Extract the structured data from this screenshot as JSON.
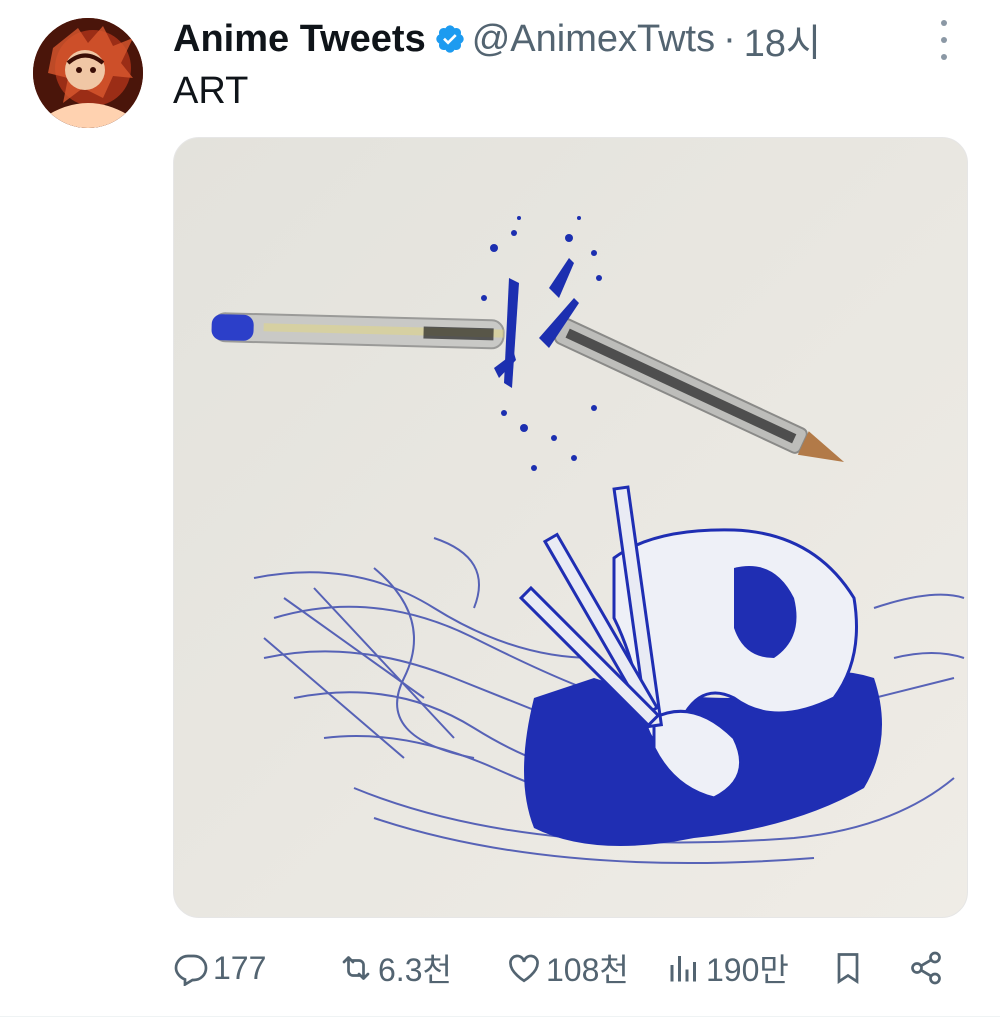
{
  "tweet": {
    "display_name": "Anime Tweets",
    "handle": "@AnimexTwts",
    "separator": "·",
    "time": "18시",
    "text": "ART",
    "image_alt": "Ballpoint pen drawing of a sword swing slicing a real pen in half",
    "verified_color": "#1d9bf0"
  },
  "actions": {
    "replies": "177",
    "retweets": "6.3천",
    "likes": "108천",
    "views": "190만"
  },
  "icons": [
    "reply-icon",
    "retweet-icon",
    "like-icon",
    "views-icon",
    "bookmark-icon",
    "share-icon",
    "verified-icon",
    "more-icon"
  ]
}
